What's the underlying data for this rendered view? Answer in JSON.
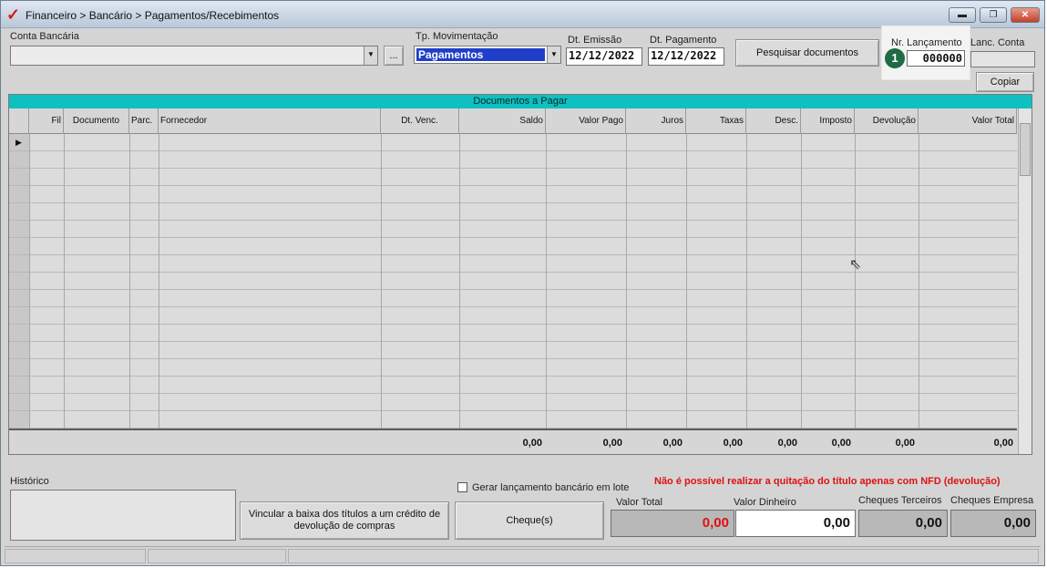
{
  "window": {
    "title": "Financeiro > Bancário > Pagamentos/Recebimentos",
    "title_icon": "checkmark-icon",
    "controls": [
      "minimize",
      "restore",
      "close"
    ]
  },
  "toolbar": {
    "conta_bancaria_label": "Conta Bancária",
    "conta_bancaria_value": "",
    "browse_button": "...",
    "tp_movimentacao_label": "Tp. Movimentação",
    "tp_movimentacao_value": "Pagamentos",
    "dt_emissao_label": "Dt. Emissão",
    "dt_emissao_value": "12/12/2022",
    "dt_pagamento_label": "Dt. Pagamento",
    "dt_pagamento_value": "12/12/2022",
    "pesquisar_button": "Pesquisar documentos",
    "nr_lancamento_label": "Nr. Lançamento",
    "nr_lancamento_value": "000000",
    "badge": "1",
    "lanc_conta_label": "Lanc. Conta",
    "lanc_conta_value": "",
    "copiar_button": "Copiar"
  },
  "grid": {
    "title": "Documentos a Pagar",
    "columns": [
      "Fil",
      "Documento",
      "Parc.",
      "Fornecedor",
      "Dt. Venc.",
      "Saldo",
      "Valor Pago",
      "Juros",
      "Taxas",
      "Desc.",
      "Imposto",
      "Devolução",
      "Valor Total"
    ],
    "rows": [],
    "totals": [
      "0,00",
      "0,00",
      "0,00",
      "0,00",
      "0,00",
      "0,00",
      "0,00",
      "0,00"
    ]
  },
  "bottom": {
    "historico_label": "Histórico",
    "historico_value": "",
    "vincular_button": "Vincular a baixa dos títulos a um crédito de devolução de compras",
    "gerar_lote_label": "Gerar lançamento bancário em lote",
    "gerar_lote_checked": false,
    "cheques_button": "Cheque(s)",
    "warning": "Não é possível realizar a quitação do título apenas com NFD (devolução)",
    "warning_color": "#e01010",
    "valor_total_label": "Valor Total",
    "valor_total": "0,00",
    "valor_dinheiro_label": "Valor Dinheiro",
    "valor_dinheiro": "0,00",
    "cheques_terceiros_label": "Cheques Terceiros",
    "cheques_terceiros": "0,00",
    "cheques_empresa_label": "Cheques Empresa",
    "cheques_empresa": "0,00"
  },
  "colors": {
    "grid_title": "#0fc0c0",
    "selection": "#1f3fc8",
    "badge": "#1f6b45"
  }
}
